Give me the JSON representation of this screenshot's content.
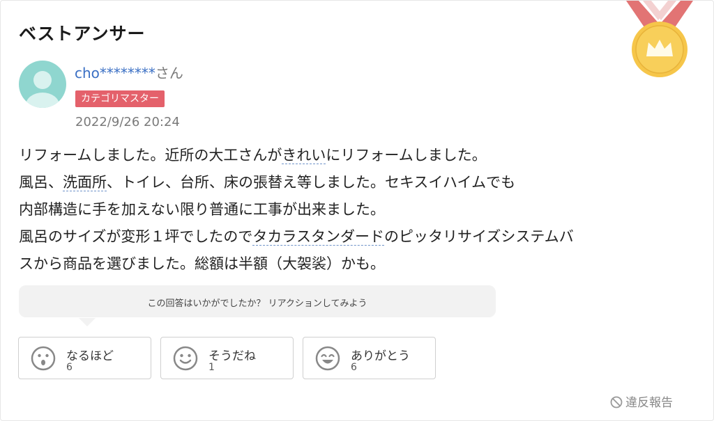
{
  "section_title": "ベストアンサー",
  "user": {
    "name": "cho********",
    "suffix": "さん",
    "badge": "カテゴリマスター",
    "date": "2022/9/26 20:24"
  },
  "answer": {
    "line1": [
      "リフォームしました。近所の大工さんが",
      "きれい",
      "にリフォームしました。"
    ],
    "line2": [
      "風呂、",
      "洗面所",
      "、トイレ、台所、床の張替え等しました。セキスイハイムでも"
    ],
    "line3": "内部構造に手を加えない限り普通に工事が出来ました。",
    "line4": [
      "風呂のサイズが変形１坪でしたので",
      "タカラスタンダード",
      "のピッタリサイズシステムバ"
    ],
    "line5": "スから商品を選びました。総額は半額（大袈裟）かも。"
  },
  "reaction_prompt": "この回答はいかがでしたか？ リアクションしてみよう",
  "reactions": [
    {
      "label": "なるほど",
      "count": "6",
      "icon": "surprised-face-icon"
    },
    {
      "label": "そうだね",
      "count": "1",
      "icon": "smile-face-icon"
    },
    {
      "label": "ありがとう",
      "count": "6",
      "icon": "grin-face-icon"
    }
  ],
  "report_label": "違反報告",
  "colors": {
    "badge": "#e4616b",
    "username": "#3a6fc4",
    "medal": "#f6c64a",
    "ribbon": "#e06b6b"
  }
}
